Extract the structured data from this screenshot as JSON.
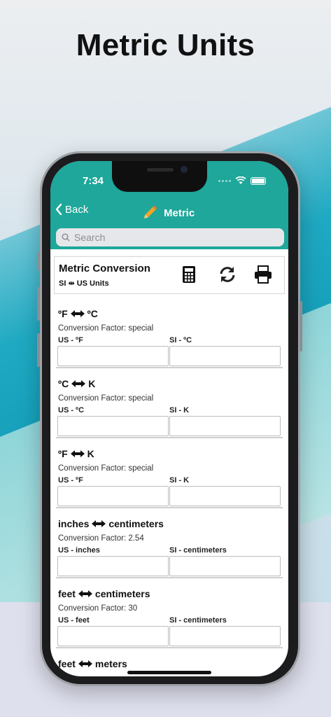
{
  "headline": "Metric Units",
  "status": {
    "time": "7:34"
  },
  "nav": {
    "back_label": "Back",
    "title": "Metric"
  },
  "search": {
    "placeholder": "Search"
  },
  "converter": {
    "title": "Metric Conversion",
    "subtitle": "SI ⇹ US Units"
  },
  "icons": {
    "pencil": "pencil-icon",
    "calculator": "calculator-icon",
    "refresh": "refresh-icon",
    "print": "printer-icon",
    "search": "search-icon",
    "back": "chevron-left-icon"
  },
  "colors": {
    "header": "#1ea79a",
    "pencil": "#f2a428"
  },
  "conversions": [
    {
      "us_unit": "ºF",
      "si_unit": "ºC",
      "factor": "Conversion Factor: special",
      "us_label": "US - ºF",
      "si_label": "SI - ºC"
    },
    {
      "us_unit": "ºC",
      "si_unit": "K",
      "factor": "Conversion Factor: special",
      "us_label": "US - ºC",
      "si_label": "SI - K"
    },
    {
      "us_unit": "ºF",
      "si_unit": "K",
      "factor": "Conversion Factor: special",
      "us_label": "US - ºF",
      "si_label": "SI - K"
    },
    {
      "us_unit": "inches",
      "si_unit": "centimeters",
      "factor": "Conversion Factor: 2.54",
      "us_label": "US - inches",
      "si_label": "SI - centimeters"
    },
    {
      "us_unit": "feet",
      "si_unit": "centimeters",
      "factor": "Conversion Factor: 30",
      "us_label": "US - feet",
      "si_label": "SI - centimeters"
    },
    {
      "us_unit": "feet",
      "si_unit": "meters",
      "factor": "",
      "us_label": "",
      "si_label": ""
    }
  ]
}
